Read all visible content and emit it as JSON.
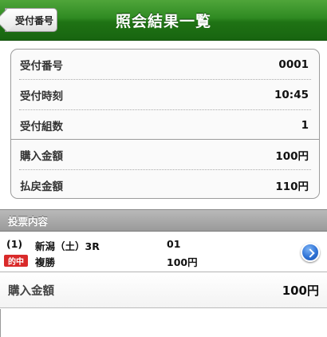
{
  "header": {
    "back_label": "受付番号",
    "title": "照会結果一覧"
  },
  "info": {
    "rows": [
      {
        "label": "受付番号",
        "value": "0001"
      },
      {
        "label": "受付時刻",
        "value": "10:45"
      },
      {
        "label": "受付組数",
        "value": "1"
      },
      {
        "label": "購入金額",
        "value": "100円"
      },
      {
        "label": "払戻金額",
        "value": "110円"
      }
    ]
  },
  "section": {
    "title": "投票内容"
  },
  "bet": {
    "index": "(1)",
    "race": "新潟（土）3R",
    "number": "01",
    "badge": "的中",
    "bet_type": "複勝",
    "amount": "100円"
  },
  "total": {
    "label": "購入金額",
    "value": "100円"
  },
  "colors": {
    "header_green": "#2f8a22",
    "hit_red": "#d92a2a",
    "detail_blue": "#2f73d6"
  }
}
